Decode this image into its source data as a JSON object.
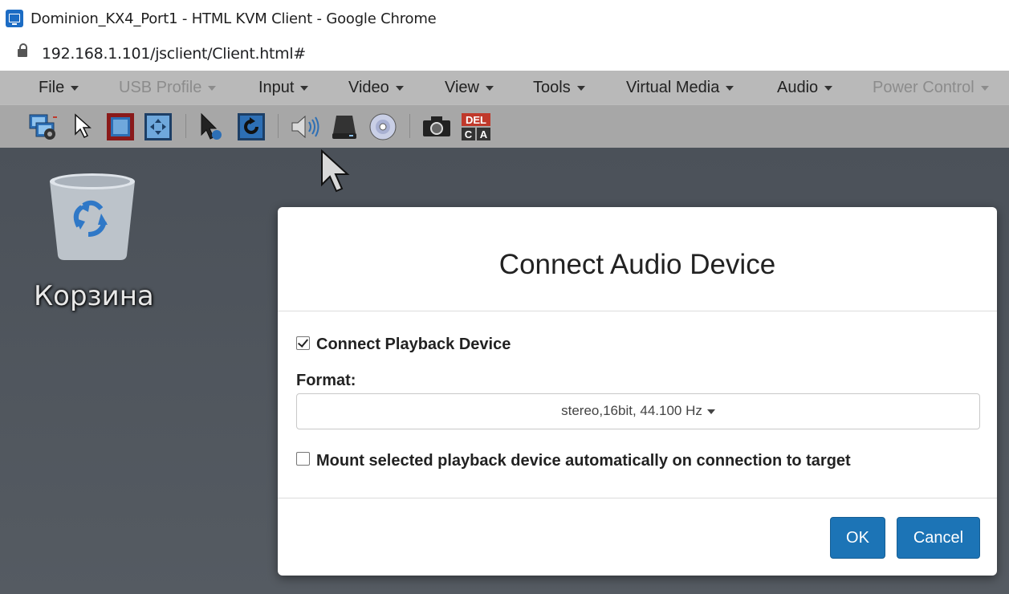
{
  "window": {
    "title": "Dominion_KX4_Port1 - HTML KVM Client - Google Chrome",
    "url": "192.168.1.101/jsclient/Client.html#"
  },
  "menu": {
    "items": [
      {
        "label": "File",
        "enabled": true
      },
      {
        "label": "USB Profile",
        "enabled": false
      },
      {
        "label": "Input",
        "enabled": true
      },
      {
        "label": "Video",
        "enabled": true
      },
      {
        "label": "View",
        "enabled": true
      },
      {
        "label": "Tools",
        "enabled": true
      },
      {
        "label": "Virtual Media",
        "enabled": true
      },
      {
        "label": "Audio",
        "enabled": true
      },
      {
        "label": "Power Control",
        "enabled": false
      }
    ]
  },
  "toolbar": {
    "icons": [
      "connection-properties-icon",
      "single-mouse-cursor-icon",
      "fullscreen-icon",
      "fit-window-icon",
      "synchronize-mouse-icon",
      "refresh-icon",
      "audio-icon",
      "drive-icon",
      "cd-dvd-icon",
      "screenshot-icon",
      "ctrl-alt-del-icon"
    ],
    "cad_top": "DEL",
    "cad_bottom_left": "C",
    "cad_bottom_right": "A"
  },
  "desktop": {
    "recycle_bin_label": "Корзина"
  },
  "dialog": {
    "title": "Connect Audio Device",
    "connect_playback_label": "Connect Playback Device",
    "connect_playback_checked": true,
    "format_label": "Format:",
    "format_value": "stereo,16bit, 44.100 Hz",
    "auto_mount_label": "Mount selected playback device automatically on connection to target",
    "auto_mount_checked": false,
    "ok_label": "OK",
    "cancel_label": "Cancel"
  },
  "colors": {
    "primary_button": "#1c74b6",
    "menubar": "#b9b9b9",
    "toolbar": "#a7a7a7",
    "desktop": "#4b5159"
  }
}
